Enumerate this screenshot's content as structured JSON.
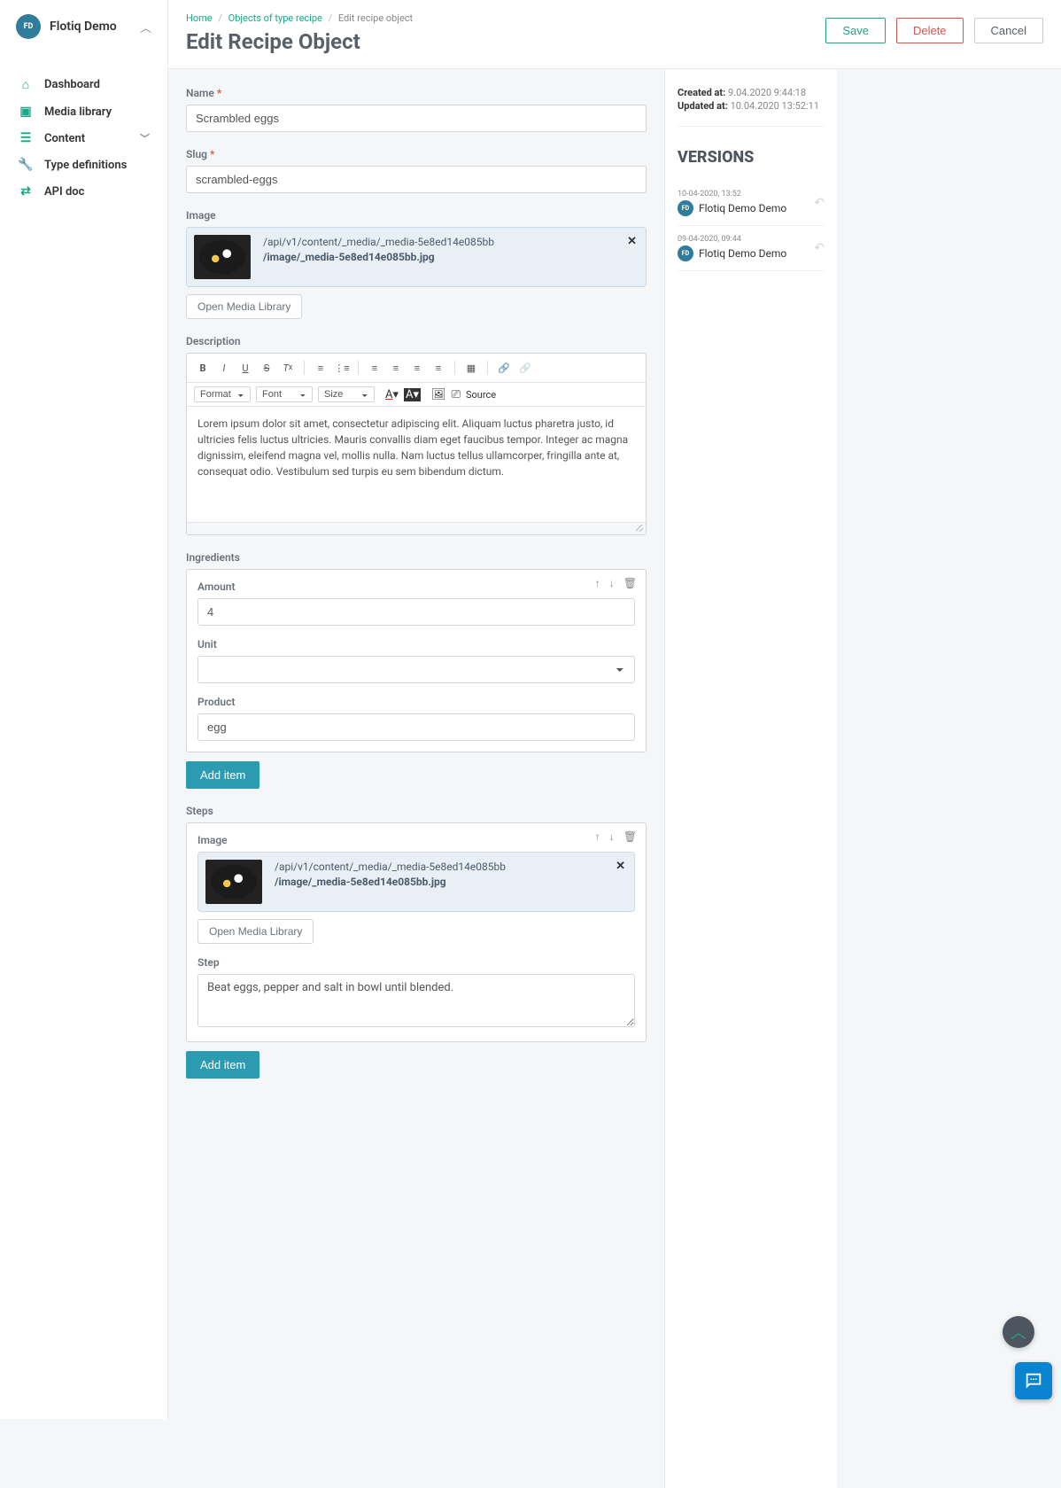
{
  "brand": {
    "badge": "FD",
    "name": "Flotiq Demo"
  },
  "nav": {
    "dashboard": "Dashboard",
    "media": "Media library",
    "content": "Content",
    "types": "Type definitions",
    "apidoc": "API doc"
  },
  "breadcrumb": {
    "home": "Home",
    "objects": "Objects of type recipe",
    "current": "Edit recipe object"
  },
  "page_title": "Edit Recipe Object",
  "actions": {
    "save": "Save",
    "delete": "Delete",
    "cancel": "Cancel"
  },
  "fields": {
    "name": {
      "label": "Name",
      "value": "Scrambled eggs"
    },
    "slug": {
      "label": "Slug",
      "value": "scrambled-eggs"
    },
    "image": {
      "label": "Image",
      "path1": "/api/v1/content/_media/_media-5e8ed14e085bb",
      "path2": "/image/_media-5e8ed14e085bb.jpg",
      "open": "Open Media Library"
    },
    "description": {
      "label": "Description",
      "toolbar": {
        "format": "Format",
        "font": "Font",
        "size": "Size",
        "source": "Source"
      },
      "body": "Lorem ipsum dolor sit amet, consectetur adipiscing elit. Aliquam luctus pharetra justo, id ultricies felis luctus ultricies. Mauris convallis diam eget faucibus tempor. Integer ac magna dignissim, eleifend magna vel, mollis nulla. Nam luctus tellus ullamcorper, fringilla ante at, consequat odio. Vestibulum sed turpis eu sem bibendum dictum."
    },
    "ingredients": {
      "label": "Ingredients",
      "amount_label": "Amount",
      "amount_value": "4",
      "unit_label": "Unit",
      "unit_value": "",
      "product_label": "Product",
      "product_value": "egg",
      "add": "Add item"
    },
    "steps": {
      "label": "Steps",
      "image_label": "Image",
      "image_path1": "/api/v1/content/_media/_media-5e8ed14e085bb",
      "image_path2": "/image/_media-5e8ed14e085bb.jpg",
      "open": "Open Media Library",
      "step_label": "Step",
      "step_value": "Beat eggs, pepper and salt in bowl until blended.",
      "add": "Add item"
    }
  },
  "meta": {
    "created_label": "Created at:",
    "created_value": "9.04.2020 9:44:18",
    "updated_label": "Updated at:",
    "updated_value": "10.04.2020 13:52:11"
  },
  "versions": {
    "title": "VERSIONS",
    "items": [
      {
        "date": "10-04-2020, 13:52",
        "author": "Flotiq Demo Demo",
        "badge": "FD"
      },
      {
        "date": "09-04-2020, 09:44",
        "author": "Flotiq Demo Demo",
        "badge": "FD"
      }
    ]
  }
}
